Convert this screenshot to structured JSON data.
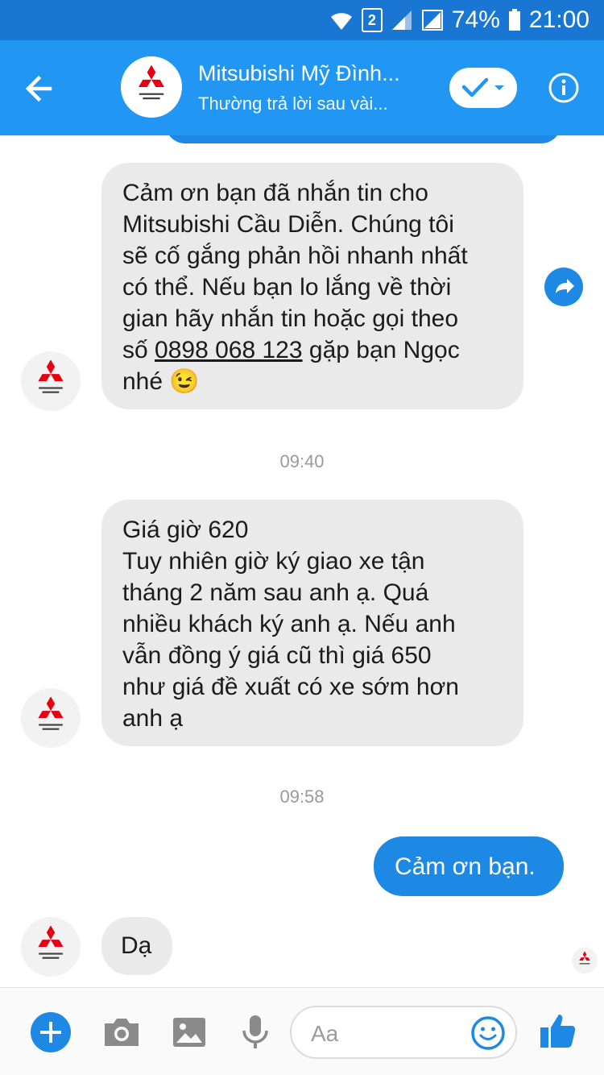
{
  "status_bar": {
    "battery": "74%",
    "time": "21:00",
    "sim": "2"
  },
  "header": {
    "contact_name": "Mitsubishi Mỹ Đình...",
    "contact_status": "Thường trả lời sau vài...",
    "avatar_logo": "mitsubishi-logo"
  },
  "messages": [
    {
      "lines": [
        "Cảm ơn bạn đã nhắn tin cho",
        "Mitsubishi Cầu Diễn. Chúng tôi",
        "sẽ cố gắng phản hồi nhanh nhất",
        "có thể. Nếu bạn lo lắng về thời",
        "gian hãy nhắn tin hoặc gọi theo"
      ],
      "line6_prefix": "số",
      "phone": "0898 068 123",
      "line6_suffix": "gặp bạn Ngọc",
      "line7": "nhé",
      "emoji": "😉"
    },
    {
      "lines": [
        "Giá giờ 620",
        "Tuy nhiên giờ ký giao xe tận",
        "tháng 2 năm sau anh ạ. Quá",
        "nhiều khách ký anh ạ. Nếu anh",
        "vẫn đồng ý giá cũ thì giá 650",
        "như giá đề xuất có xe sớm hơn",
        "anh ạ"
      ]
    },
    {
      "text": "Cảm ơn bạn."
    },
    {
      "text": "Dạ"
    }
  ],
  "timestamps": [
    "09:40",
    "09:58"
  ],
  "composer": {
    "placeholder": "Aa"
  },
  "colors": {
    "status_bar": "#1976d2",
    "header": "#2196f3",
    "outgoing_bubble": "#1e88e5",
    "incoming_bubble": "#eaeaea",
    "logo_red": "#e60012"
  }
}
